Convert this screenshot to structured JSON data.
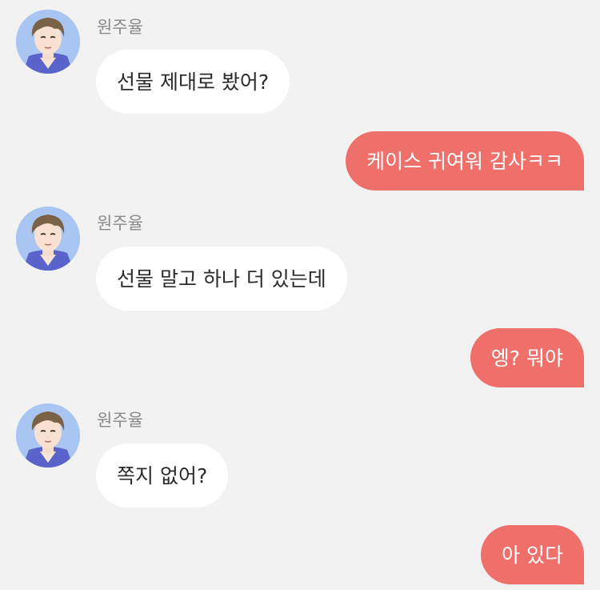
{
  "colors": {
    "background": "#f2f2f2",
    "incoming_bubble": "#ffffff",
    "outgoing_bubble": "#ef706b",
    "sender_name": "#8a8a8a"
  },
  "messages": [
    {
      "direction": "incoming",
      "sender": "원주율",
      "avatar": "avatar-icon",
      "text": "선물 제대로 봤어?"
    },
    {
      "direction": "outgoing",
      "text": "케이스 귀여워 감사ㅋㅋ"
    },
    {
      "direction": "incoming",
      "sender": "원주율",
      "avatar": "avatar-icon",
      "text": "선물 말고 하나 더 있는데"
    },
    {
      "direction": "outgoing",
      "text": "엥? 뭐야"
    },
    {
      "direction": "incoming",
      "sender": "원주율",
      "avatar": "avatar-icon",
      "text": "쪽지 없어?"
    },
    {
      "direction": "outgoing",
      "text": "아 있다"
    }
  ]
}
